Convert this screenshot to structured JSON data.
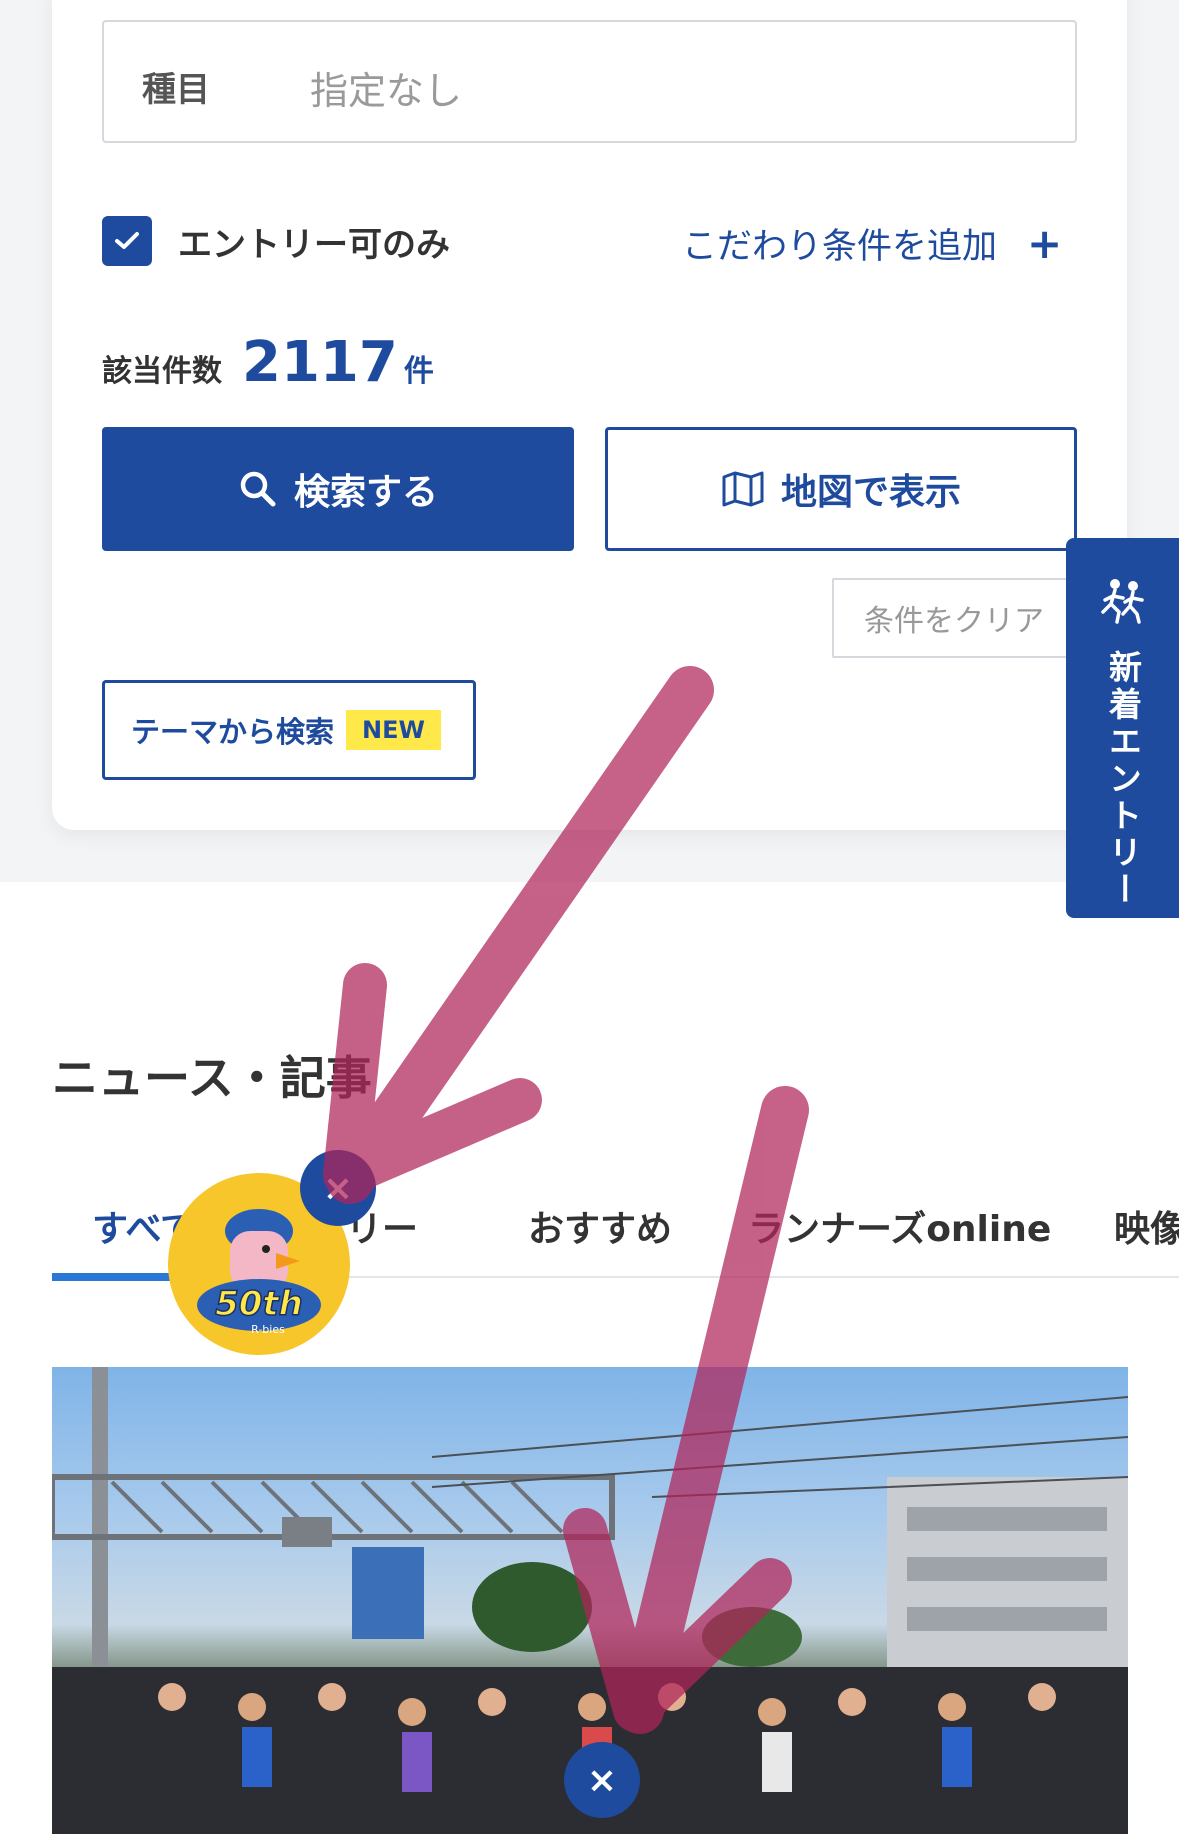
{
  "search": {
    "category_label": "種目",
    "category_value": "指定なし",
    "entry_only_label": "エントリー可のみ",
    "entry_only_checked": true,
    "add_condition_label": "こだわり条件を追加",
    "add_condition_icon": "plus-icon",
    "count_label": "該当件数",
    "count_value": "2117",
    "count_unit": "件",
    "search_button": "検索する",
    "map_button": "地図で表示",
    "clear_button": "条件をクリア",
    "theme_button": "テーマから検索",
    "theme_badge": "NEW"
  },
  "side_tab": {
    "label": "新着エントリー",
    "icon": "runners-icon"
  },
  "news": {
    "title": "ニュース・記事",
    "tabs": [
      "すべて",
      "エントリー",
      "おすすめ",
      "ランナーズonline",
      "映像"
    ],
    "active_tab": 0
  },
  "mascot": {
    "text": "50th",
    "subtext": "R-bies"
  },
  "colors": {
    "primary": "#1f4b9e",
    "accent": "#2a78d6",
    "badge": "#ffe94a",
    "arrow": "#b0245a"
  }
}
